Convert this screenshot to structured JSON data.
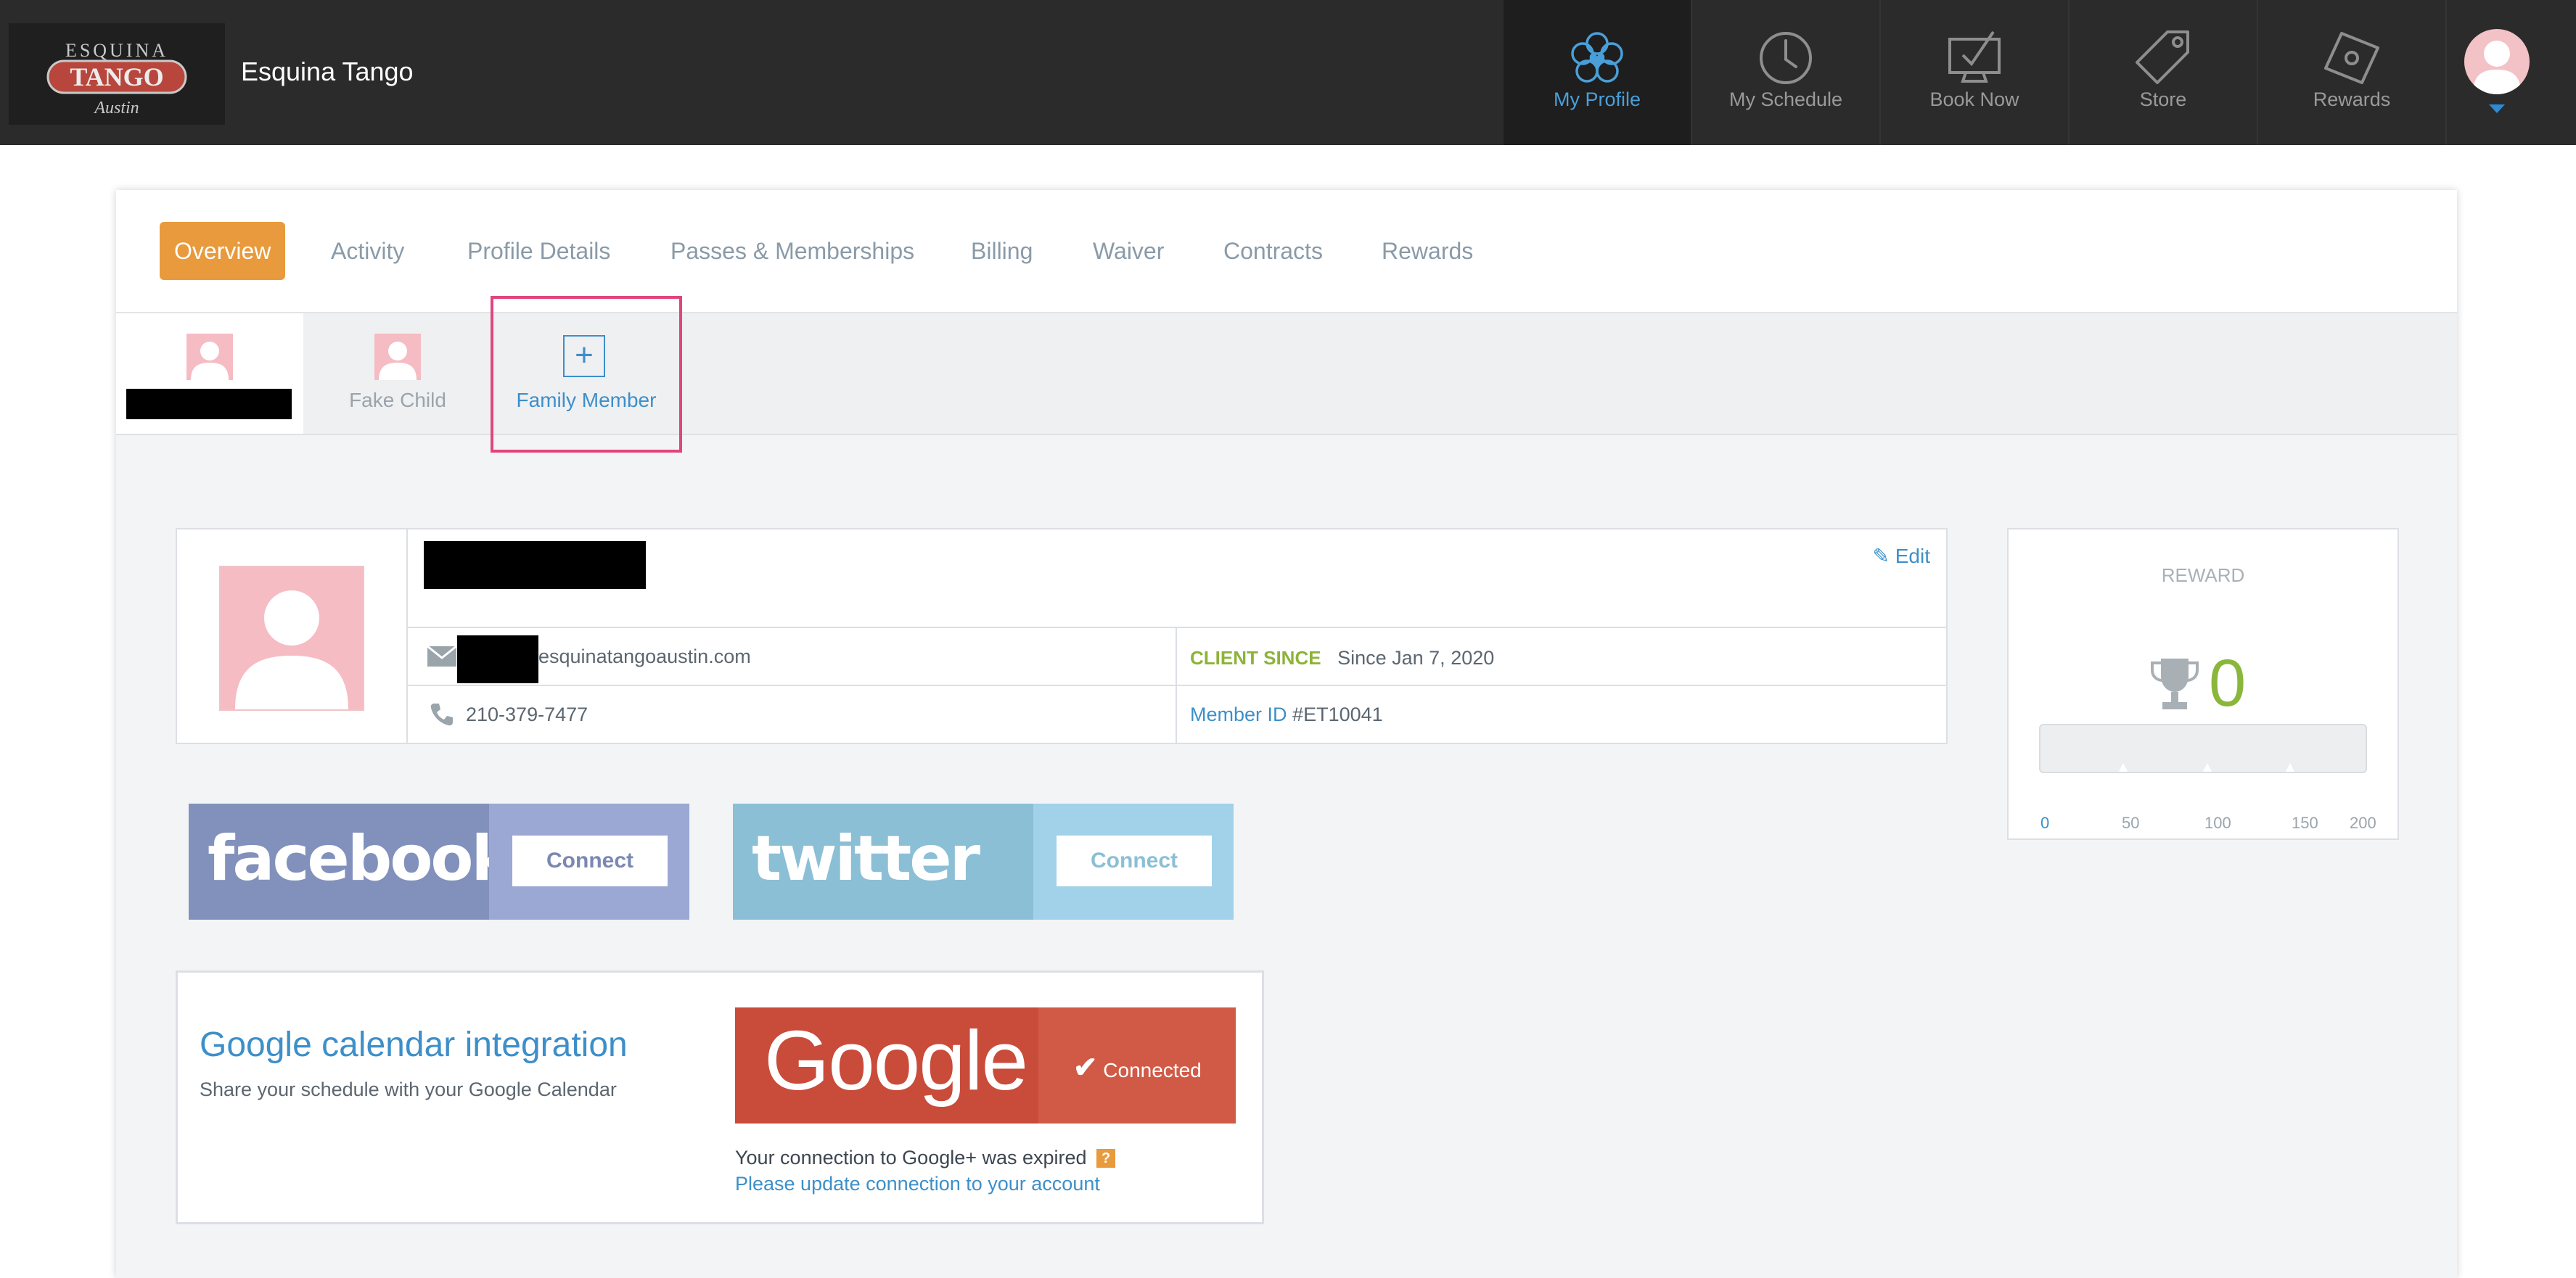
{
  "brand": {
    "logo_lines": [
      "ESQUINA",
      "TANGO",
      "Austin"
    ],
    "name": "Esquina Tango"
  },
  "nav": {
    "items": [
      {
        "label": "My Profile",
        "icon": "heart-flower-icon",
        "active": true
      },
      {
        "label": "My Schedule",
        "icon": "clock-icon",
        "active": false
      },
      {
        "label": "Book Now",
        "icon": "monitor-check-icon",
        "active": false
      },
      {
        "label": "Store",
        "icon": "tag-icon",
        "active": false
      },
      {
        "label": "Rewards",
        "icon": "ticket-tag-icon",
        "active": false
      }
    ],
    "avatar_icon": "user-avatar-icon"
  },
  "tabs": [
    {
      "label": "Overview",
      "active": true
    },
    {
      "label": "Activity"
    },
    {
      "label": "Profile Details"
    },
    {
      "label": "Passes & Memberships"
    },
    {
      "label": "Billing"
    },
    {
      "label": "Waiver"
    },
    {
      "label": "Contracts"
    },
    {
      "label": "Rewards"
    }
  ],
  "members": {
    "child_name": "Fake Child",
    "add_label": "Family Member",
    "add_symbol": "+"
  },
  "profile": {
    "edit_label": "Edit",
    "email_suffix": "esquinatangoaustin.com",
    "phone": "210-379-7477",
    "client_since_label": "CLIENT SINCE",
    "client_since_value": "Since Jan 7, 2020",
    "member_id_label": "Member ID",
    "member_id_value": "#ET10041"
  },
  "reward": {
    "title": "REWARD",
    "count": "0",
    "progress_value": 0,
    "progress_max": 200,
    "ticks": [
      "0",
      "50",
      "100",
      "150",
      "200"
    ]
  },
  "social": {
    "facebook": {
      "wordmark": "facebook",
      "button": "Connect"
    },
    "twitter": {
      "wordmark": "twitter",
      "button": "Connect"
    }
  },
  "google": {
    "title": "Google calendar integration",
    "subtitle": "Share your schedule with your Google Calendar",
    "wordmark": "Google",
    "check": "✔",
    "status": "Connected",
    "expired_text": "Your connection to Google+ was expired",
    "help": "?",
    "update_link": "Please update connection to your account"
  },
  "colors": {
    "topbar": "#2b2b2b",
    "accent_blue": "#3d8fc9",
    "tab_active": "#e89a3c",
    "reward_green": "#8bb63c",
    "facebook": "#8191bb",
    "twitter": "#8bbfd6",
    "google": "#c94b39",
    "highlight": "#e0457e"
  }
}
